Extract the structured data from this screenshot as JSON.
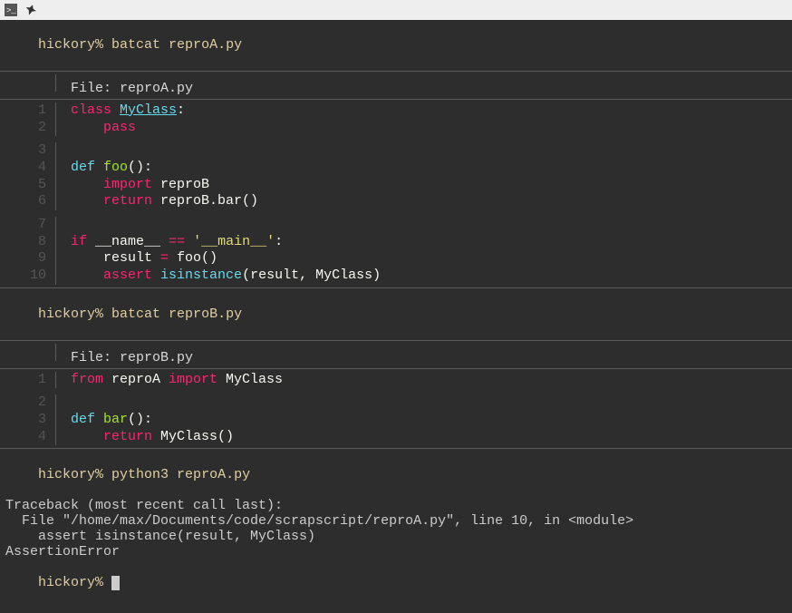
{
  "titlebar": {
    "terminal_icon": "❯_",
    "pin_icon": "📌"
  },
  "prompt": "hickory%",
  "commands": {
    "cat1": "batcat reproA.py",
    "cat2": "batcat reproB.py",
    "run": "python3 reproA.py"
  },
  "fileA": {
    "header": "File: reproA.py",
    "lines": [
      {
        "n": "1",
        "tokens": [
          [
            "kw-red",
            "class "
          ],
          [
            "kw-cyan-u",
            "MyClass"
          ],
          [
            "plain",
            ":"
          ]
        ]
      },
      {
        "n": "2",
        "tokens": [
          [
            "plain",
            "    "
          ],
          [
            "kw-red",
            "pass"
          ]
        ]
      },
      {
        "n": "3",
        "tokens": []
      },
      {
        "n": "4",
        "tokens": [
          [
            "kw-cyan",
            "def "
          ],
          [
            "kw-green",
            "foo"
          ],
          [
            "plain",
            "():"
          ]
        ]
      },
      {
        "n": "5",
        "tokens": [
          [
            "plain",
            "    "
          ],
          [
            "kw-red",
            "import"
          ],
          [
            "plain",
            " reproB"
          ]
        ]
      },
      {
        "n": "6",
        "tokens": [
          [
            "plain",
            "    "
          ],
          [
            "kw-red",
            "return"
          ],
          [
            "plain",
            " reproB.bar()"
          ]
        ]
      },
      {
        "n": "7",
        "tokens": []
      },
      {
        "n": "8",
        "tokens": [
          [
            "kw-red",
            "if"
          ],
          [
            "plain",
            " __name__ "
          ],
          [
            "op",
            "=="
          ],
          [
            "plain",
            " "
          ],
          [
            "str",
            "'__main__'"
          ],
          [
            "plain",
            ":"
          ]
        ]
      },
      {
        "n": "9",
        "tokens": [
          [
            "plain",
            "    result "
          ],
          [
            "op",
            "="
          ],
          [
            "plain",
            " foo()"
          ]
        ]
      },
      {
        "n": "10",
        "tokens": [
          [
            "plain",
            "    "
          ],
          [
            "kw-red",
            "assert"
          ],
          [
            "plain",
            " "
          ],
          [
            "kw-cyan",
            "isinstance"
          ],
          [
            "plain",
            "(result, MyClass)"
          ]
        ]
      }
    ]
  },
  "fileB": {
    "header": "File: reproB.py",
    "lines": [
      {
        "n": "1",
        "tokens": [
          [
            "kw-red",
            "from"
          ],
          [
            "plain",
            " reproA "
          ],
          [
            "kw-red",
            "import"
          ],
          [
            "plain",
            " MyClass"
          ]
        ]
      },
      {
        "n": "2",
        "tokens": []
      },
      {
        "n": "3",
        "tokens": [
          [
            "kw-cyan",
            "def "
          ],
          [
            "kw-green",
            "bar"
          ],
          [
            "plain",
            "():"
          ]
        ]
      },
      {
        "n": "4",
        "tokens": [
          [
            "plain",
            "    "
          ],
          [
            "kw-red",
            "return"
          ],
          [
            "plain",
            " MyClass()"
          ]
        ]
      }
    ]
  },
  "traceback": {
    "l1": "Traceback (most recent call last):",
    "l2": "  File \"/home/max/Documents/code/scrapscript/reproA.py\", line 10, in <module>",
    "l3": "    assert isinstance(result, MyClass)",
    "l4": "AssertionError"
  }
}
